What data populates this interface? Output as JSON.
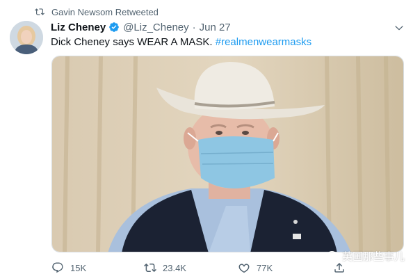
{
  "retweet": {
    "text": "Gavin Newsom Retweeted",
    "icon": "retweet-icon"
  },
  "author": {
    "display_name": "Liz Cheney",
    "verified": true,
    "handle": "@Liz_Cheney",
    "separator": "·",
    "date": "Jun 27"
  },
  "tweet": {
    "text": "Dick Cheney says WEAR A MASK.",
    "hashtag": "#realmenwearmasks"
  },
  "media": {
    "kind": "photo"
  },
  "actions": {
    "replies": "15K",
    "retweets": "23.4K",
    "likes": "77K",
    "share_icon": "share-icon"
  },
  "watermark": {
    "text": "英国那些事儿"
  },
  "colors": {
    "link_blue": "#1d9bf0",
    "verified_blue": "#1d9bf0",
    "secondary_text": "#536471"
  }
}
